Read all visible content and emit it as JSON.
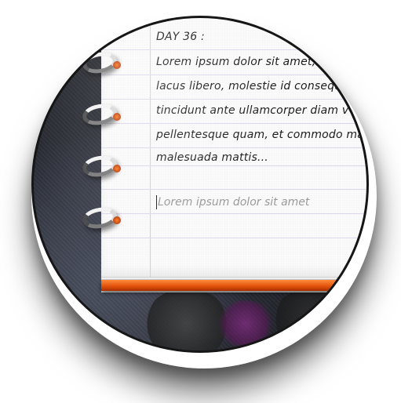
{
  "journal": {
    "day_title": "DAY 36 :",
    "entry_lines": [
      "Lorem ipsum dolor sit amet,",
      "lacus libero, molestie id consequ",
      "tincidunt ante ullamcorper diam v",
      "pellentesque quam, et commodo ma",
      "malesuada mattis..."
    ],
    "new_entry_placeholder": "Lorem ipsum dolor sit amet"
  },
  "colors": {
    "cover_orange": "#e0500a",
    "ruled_line": "#ddd6ea",
    "ink": "#1b1b1b"
  }
}
